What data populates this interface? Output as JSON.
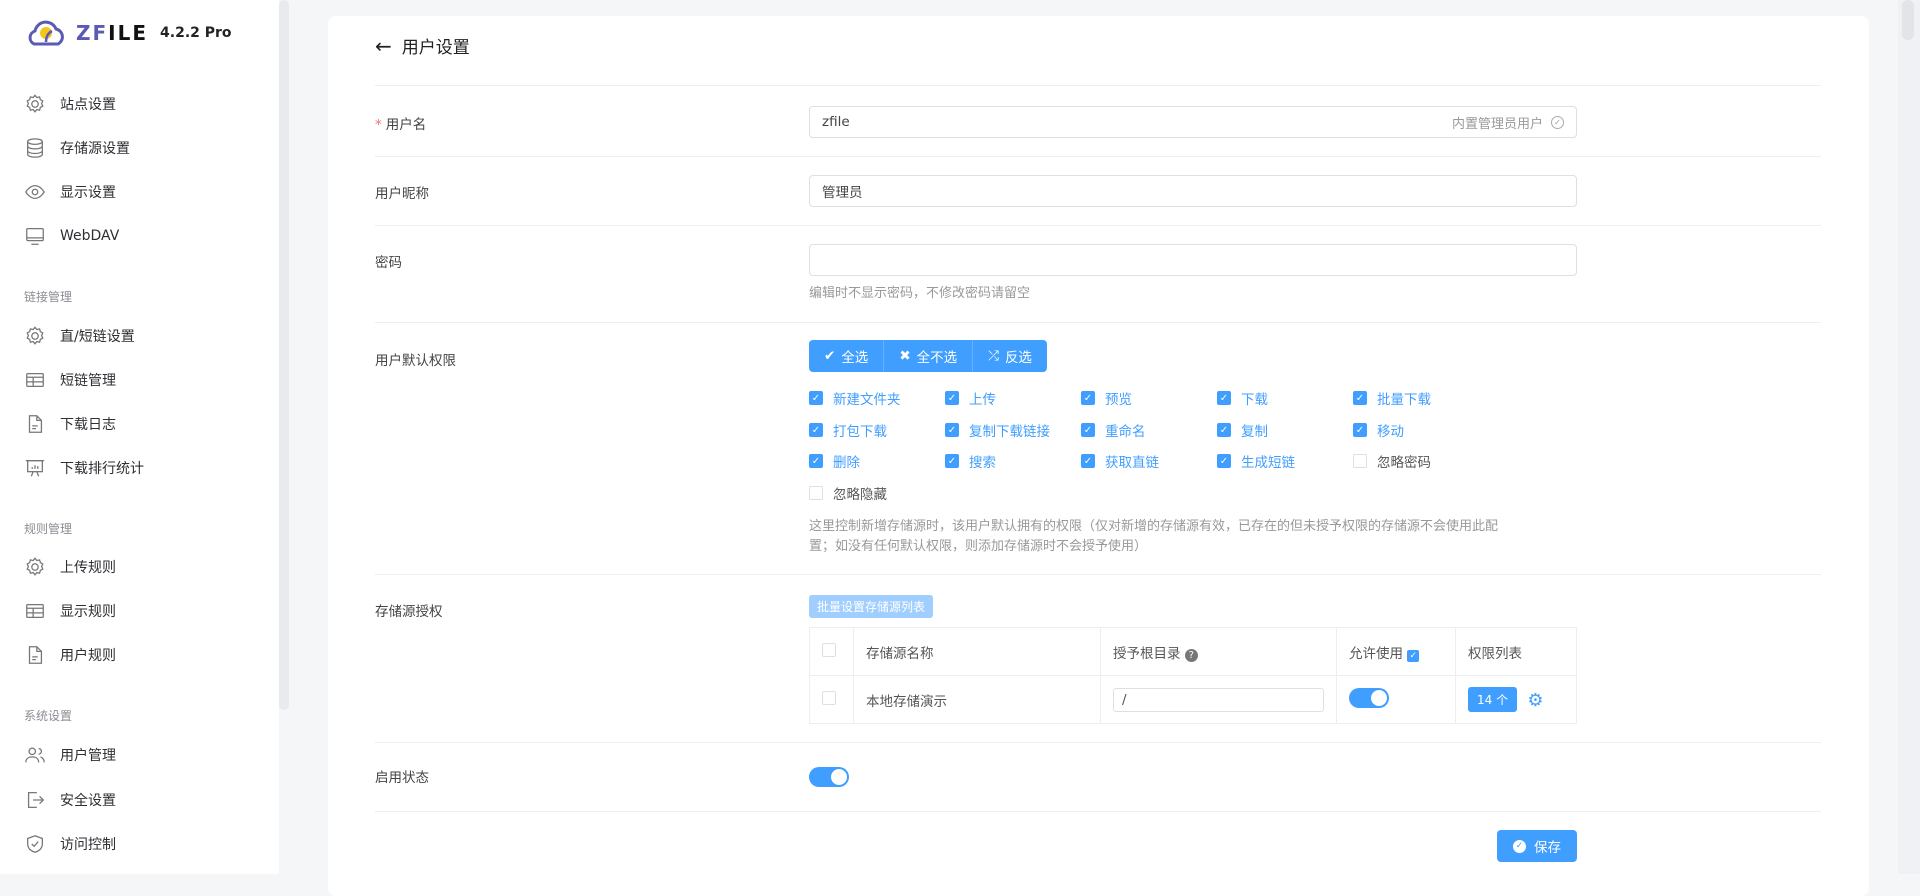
{
  "app": {
    "name_prefix": "ZF",
    "name_suffix": "ILE",
    "version": "4.2.2 Pro"
  },
  "sidebar": {
    "items": [
      {
        "label": "站点设置",
        "icon": "gear-icon"
      },
      {
        "label": "存储源设置",
        "icon": "database-icon"
      },
      {
        "label": "显示设置",
        "icon": "eye-icon"
      },
      {
        "label": "WebDAV",
        "icon": "monitor-icon"
      }
    ],
    "groups": [
      {
        "title": "链接管理",
        "items": [
          {
            "label": "直/短链设置",
            "icon": "gear-icon"
          },
          {
            "label": "短链管理",
            "icon": "table-icon"
          },
          {
            "label": "下载日志",
            "icon": "document-icon"
          },
          {
            "label": "下载排行统计",
            "icon": "chart-board-icon"
          }
        ]
      },
      {
        "title": "规则管理",
        "items": [
          {
            "label": "上传规则",
            "icon": "gear-icon"
          },
          {
            "label": "显示规则",
            "icon": "table-icon"
          },
          {
            "label": "用户规则",
            "icon": "document-icon"
          }
        ]
      },
      {
        "title": "系统设置",
        "items": [
          {
            "label": "用户管理",
            "icon": "users-icon"
          },
          {
            "label": "安全设置",
            "icon": "logout-icon"
          },
          {
            "label": "访问控制",
            "icon": "shield-icon"
          }
        ]
      }
    ]
  },
  "page": {
    "title": "用户设置"
  },
  "form": {
    "username": {
      "label": "用户名",
      "value": "zfile",
      "suffix": "内置管理员用户"
    },
    "nickname": {
      "label": "用户昵称",
      "value": "管理员"
    },
    "password": {
      "label": "密码",
      "value": "",
      "hint": "编辑时不显示密码，不修改密码请留空"
    },
    "permissions": {
      "label": "用户默认权限",
      "select_all": "全选",
      "select_none": "全不选",
      "invert": "反选",
      "items": [
        {
          "label": "新建文件夹",
          "checked": true
        },
        {
          "label": "上传",
          "checked": true
        },
        {
          "label": "预览",
          "checked": true
        },
        {
          "label": "下载",
          "checked": true
        },
        {
          "label": "批量下载",
          "checked": true
        },
        {
          "label": "打包下载",
          "checked": true
        },
        {
          "label": "复制下载链接",
          "checked": true
        },
        {
          "label": "重命名",
          "checked": true
        },
        {
          "label": "复制",
          "checked": true
        },
        {
          "label": "移动",
          "checked": true
        },
        {
          "label": "删除",
          "checked": true
        },
        {
          "label": "搜索",
          "checked": true
        },
        {
          "label": "获取直链",
          "checked": true
        },
        {
          "label": "生成短链",
          "checked": true
        },
        {
          "label": "忽略密码",
          "checked": false
        },
        {
          "label": "忽略隐藏",
          "checked": false
        }
      ],
      "hint1": "这里控制新增存储源时，该用户默认拥有的权限（仅对新增的存储源有效，已存在的但未授予权限的存储源不会使用此配",
      "hint2": "置；如没有任何默认权限，则添加存储源时不会授予使用）"
    },
    "storage": {
      "label": "存储源授权",
      "batch_button": "批量设置存储源列表",
      "columns": [
        "存储源名称",
        "授予根目录",
        "允许使用",
        "权限列表"
      ],
      "rows": [
        {
          "name": "本地存储演示",
          "root": "/",
          "enabled": true,
          "perm_count": "14 个"
        }
      ]
    },
    "status": {
      "label": "启用状态",
      "enabled": true
    },
    "save": "保存"
  },
  "colors": {
    "primary": "#409eff",
    "required": "#f56c6c"
  }
}
